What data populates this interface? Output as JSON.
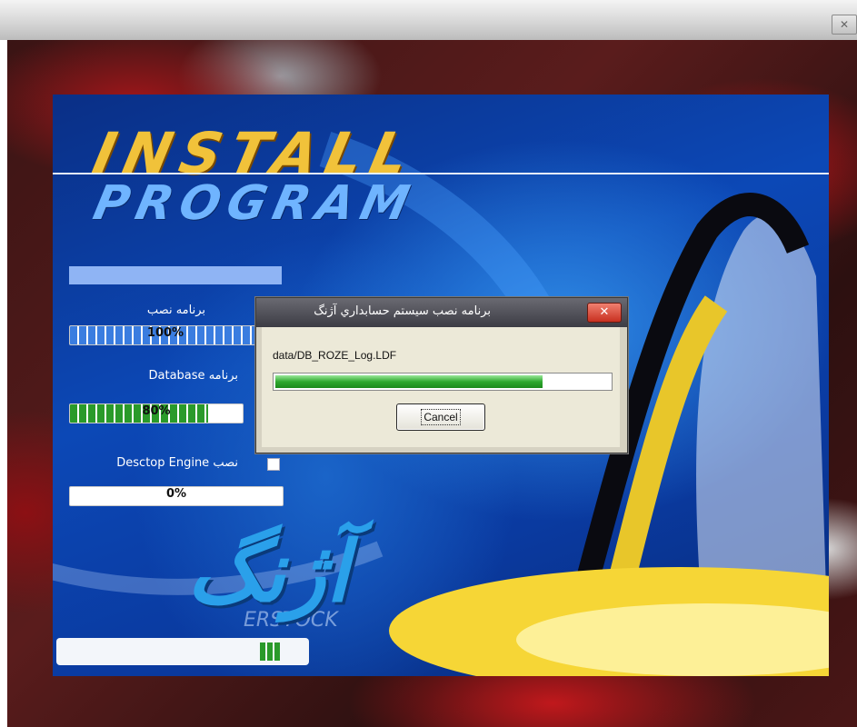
{
  "window": {
    "close_glyph": "✕"
  },
  "installer": {
    "heading_line1": "INSTALL",
    "heading_line2": "PROGRAM",
    "items": [
      {
        "label": "برنامه نصب",
        "progress_text": "100%",
        "progress": 100
      },
      {
        "label": "Database برنامه",
        "progress_text": "80%",
        "progress": 80
      },
      {
        "label": "Desctop Engine نصب",
        "progress_text": "0%",
        "progress": 0
      }
    ],
    "logo_text": "آژنگ",
    "logo_watermark": "ERSTOCK",
    "bottom_progress_fraction": 0.08
  },
  "dialog": {
    "title": "برنامه نصب سيستم حسابداري آژنگ",
    "close_glyph": "✕",
    "current_file": "data/DB_ROZE_Log.LDF",
    "progress": 80,
    "cancel_label": "Cancel"
  },
  "colors": {
    "panel_blue": "#0c48b6",
    "progress_green": "#2ea82e",
    "progress_blue": "#3a7de0",
    "heading_gold": "#f1c23a"
  }
}
